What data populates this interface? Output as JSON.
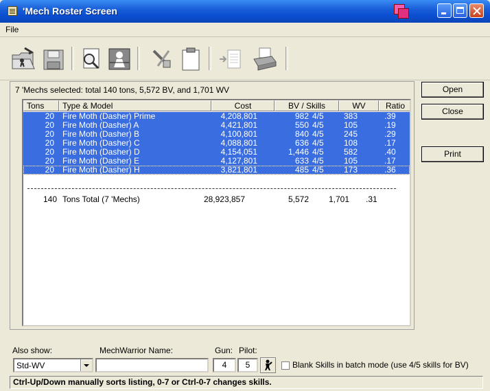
{
  "window": {
    "title": "'Mech Roster Screen"
  },
  "menu": {
    "file": "File"
  },
  "toolbar": {
    "icons": [
      "open-folder-icon",
      "save-disk-icon",
      "preview-icon",
      "roster-icon",
      "tools-icon",
      "clipboard-icon",
      "export-icon",
      "printer-icon"
    ]
  },
  "summary": "7 'Mechs selected: total 140 tons, 5,572 BV,  and  1,701 WV",
  "columns": [
    "Tons",
    "Type & Model",
    "Cost",
    "BV / Skills",
    "WV",
    "Ratio"
  ],
  "rows": [
    {
      "tons": "20",
      "model": "Fire Moth (Dasher)  Prime",
      "cost": "4,208,801",
      "bv": "982",
      "skills": "4/5",
      "wv": "383",
      "ratio": ".39"
    },
    {
      "tons": "20",
      "model": "Fire Moth (Dasher) A",
      "cost": "4,421,801",
      "bv": "550",
      "skills": "4/5",
      "wv": "105",
      "ratio": ".19"
    },
    {
      "tons": "20",
      "model": "Fire Moth (Dasher) B",
      "cost": "4,100,801",
      "bv": "840",
      "skills": "4/5",
      "wv": "245",
      "ratio": ".29"
    },
    {
      "tons": "20",
      "model": "Fire Moth (Dasher) C",
      "cost": "4,088,801",
      "bv": "636",
      "skills": "4/5",
      "wv": "108",
      "ratio": ".17"
    },
    {
      "tons": "20",
      "model": "Fire Moth (Dasher) D",
      "cost": "4,154,051",
      "bv": "1,446",
      "skills": "4/5",
      "wv": "582",
      "ratio": ".40"
    },
    {
      "tons": "20",
      "model": "Fire Moth (Dasher) E",
      "cost": "4,127,801",
      "bv": "633",
      "skills": "4/5",
      "wv": "105",
      "ratio": ".17"
    },
    {
      "tons": "20",
      "model": "Fire Moth (Dasher) H",
      "cost": "3,821,801",
      "bv": "485",
      "skills": "4/5",
      "wv": "173",
      "ratio": ".36"
    }
  ],
  "total": {
    "tons": "140",
    "label": "Tons Total (7 'Mechs)",
    "cost": "28,923,857",
    "bv": "5,572",
    "wv": "1,701",
    "ratio": ".31"
  },
  "buttons": {
    "open": "Open",
    "close": "Close",
    "print": "Print"
  },
  "bottom": {
    "also_show_label": "Also show:",
    "also_show_value": "Std-WV",
    "mechwarrior_label": "MechWarrior Name:",
    "mechwarrior_value": "",
    "gun_label": "Gun:",
    "gun_value": "4",
    "pilot_label": "Pilot:",
    "pilot_value": "5",
    "blank_skills_label": "Blank Skills in batch mode (use 4/5 skills for BV)",
    "blank_skills_checked": false
  },
  "status": "Ctrl-Up/Down manually sorts listing, 0-7 or Ctrl-0-7 changes skills."
}
